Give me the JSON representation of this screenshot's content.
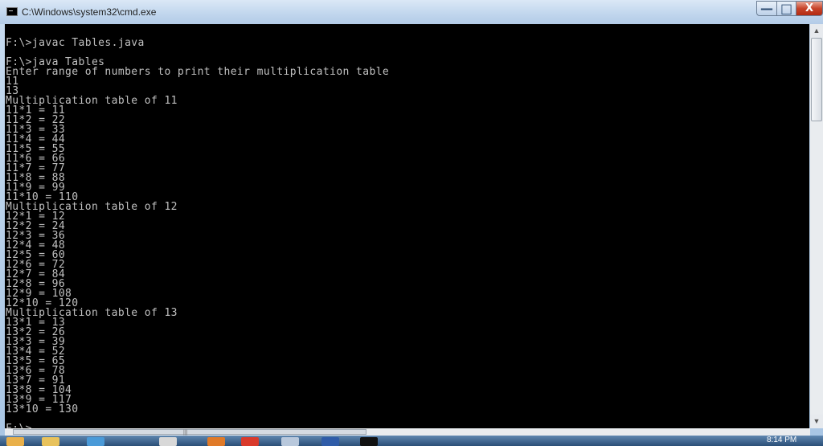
{
  "window": {
    "title": "C:\\Windows\\system32\\cmd.exe",
    "controls": {
      "minimize": "—",
      "maximize": "□",
      "close": "X"
    }
  },
  "console": {
    "lines": [
      "",
      "F:\\>javac Tables.java",
      "",
      "F:\\>java Tables",
      "Enter range of numbers to print their multiplication table",
      "11",
      "13",
      "Multiplication table of 11",
      "11*1 = 11",
      "11*2 = 22",
      "11*3 = 33",
      "11*4 = 44",
      "11*5 = 55",
      "11*6 = 66",
      "11*7 = 77",
      "11*8 = 88",
      "11*9 = 99",
      "11*10 = 110",
      "Multiplication table of 12",
      "12*1 = 12",
      "12*2 = 24",
      "12*3 = 36",
      "12*4 = 48",
      "12*5 = 60",
      "12*6 = 72",
      "12*7 = 84",
      "12*8 = 96",
      "12*9 = 108",
      "12*10 = 120",
      "Multiplication table of 13",
      "13*1 = 13",
      "13*2 = 26",
      "13*3 = 39",
      "13*4 = 52",
      "13*5 = 65",
      "13*6 = 78",
      "13*7 = 91",
      "13*8 = 104",
      "13*9 = 117",
      "13*10 = 130",
      "",
      "F:\\>"
    ]
  },
  "taskbar": {
    "clock": "8:14 PM",
    "items": [
      {
        "icon": "start-orb-icon",
        "color": "#e9b04a"
      },
      {
        "icon": "folder-icon",
        "color": "#e8c25c"
      },
      {
        "icon": "ie-icon",
        "color": "#4a9ad8"
      },
      {
        "icon": "paint-icon",
        "color": "#d8d8d8"
      },
      {
        "icon": "tools-icon",
        "color": "#e07a28"
      },
      {
        "icon": "chrome-icon",
        "color": "#d93a2c"
      },
      {
        "icon": "app-icon",
        "color": "#b8c8dc"
      },
      {
        "icon": "word-icon",
        "color": "#2f5ca8"
      },
      {
        "icon": "cmd-icon",
        "color": "#111111"
      }
    ]
  },
  "colors": {
    "console_bg": "#000000",
    "console_fg": "#c0c0c0",
    "close_button": "#c7442b"
  }
}
